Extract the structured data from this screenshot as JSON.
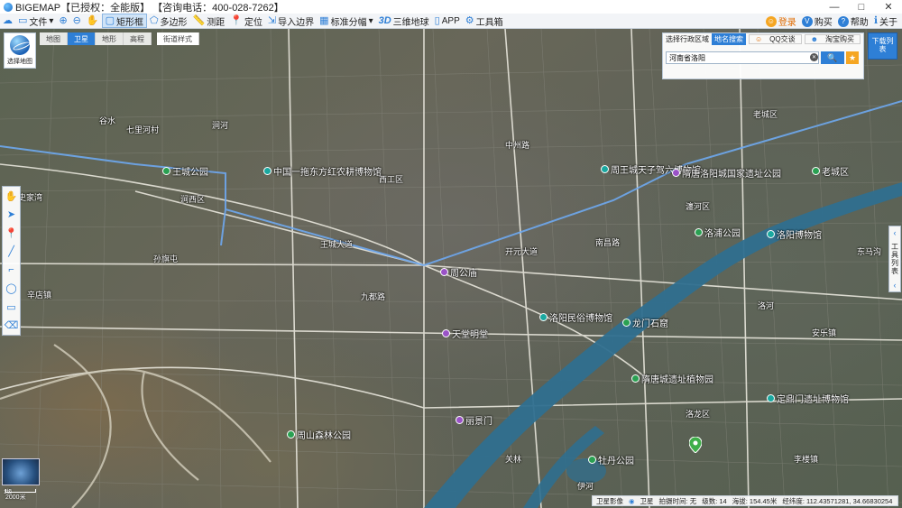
{
  "window": {
    "title": "BIGEMAP【已授权：全能版】 【咨询电话：400-028-7262】",
    "min": "—",
    "max": "□",
    "close": "✕"
  },
  "toolbar": {
    "file": "文件",
    "rect_select": "矩形框",
    "polygon": "多边形",
    "measure": "测距",
    "locate": "定位",
    "import_boundary": "导入边界",
    "grid": "标准分幅",
    "three_d": "三维地球",
    "app": "APP",
    "toolbox": "工具箱",
    "login": "登录",
    "buy": "购买",
    "help": "帮助",
    "about": "关于"
  },
  "map_widget": {
    "select_map": "选择地图",
    "types": [
      "地图",
      "卫星",
      "地形",
      "高程"
    ],
    "street_style": "街道样式"
  },
  "search": {
    "tab_admin": "选择行政区域",
    "tab_place": "地名搜索",
    "qq_label": "QQ交谈",
    "taobao_label": "淘宝购买",
    "query": "河南省洛阳",
    "download_list": "下载列表"
  },
  "right_tools": "工具列表",
  "pois": [
    {
      "name": "中国一拖东方红农耕博物馆",
      "type": "teal"
    },
    {
      "name": "周王城天子驾六博物馆",
      "type": "teal"
    },
    {
      "name": "隋唐洛阳城国家遗址公园",
      "type": "purple"
    },
    {
      "name": "王城公园",
      "type": "green"
    },
    {
      "name": "洛浦公园",
      "type": "green"
    },
    {
      "name": "洛阳博物馆",
      "type": "teal"
    },
    {
      "name": "周公庙",
      "type": "purple"
    },
    {
      "name": "天堂明堂",
      "type": "purple"
    },
    {
      "name": "隋唐城遗址植物园",
      "type": "green"
    },
    {
      "name": "洛阳民俗博物馆",
      "type": "teal"
    },
    {
      "name": "定鼎门遗址博物馆",
      "type": "teal"
    },
    {
      "name": "龙门石窟",
      "type": "green"
    },
    {
      "name": "牡丹公园",
      "type": "green"
    },
    {
      "name": "周山森林公园",
      "type": "green"
    },
    {
      "name": "丽景门",
      "type": "purple"
    },
    {
      "name": "老城区",
      "type": "green"
    }
  ],
  "places": [
    "涧西区",
    "西工区",
    "洛龙区",
    "瀍河区",
    "老城区",
    "中州路",
    "王城大道",
    "开元大道",
    "九都路",
    "南昌路",
    "涧河",
    "谷水",
    "洛河",
    "伊河",
    "七里河村",
    "史家湾",
    "东马沟",
    "安乐镇",
    "关林",
    "孙旗屯",
    "辛店镇",
    "李楼镇"
  ],
  "status": {
    "layer": "卫星影像",
    "layer_type": "卫星",
    "capture_time": "拍摄时间: 无",
    "level": "级数: 14",
    "altitude": "海拔: 154.45米",
    "coords": "经纬度: 112.43571281, 34.66830254"
  },
  "scale": {
    "zoom": "1级",
    "distance": "2000米"
  },
  "colors": {
    "accent": "#2e7fd6",
    "river": "#2f6f8f",
    "login": "#f5a623"
  }
}
